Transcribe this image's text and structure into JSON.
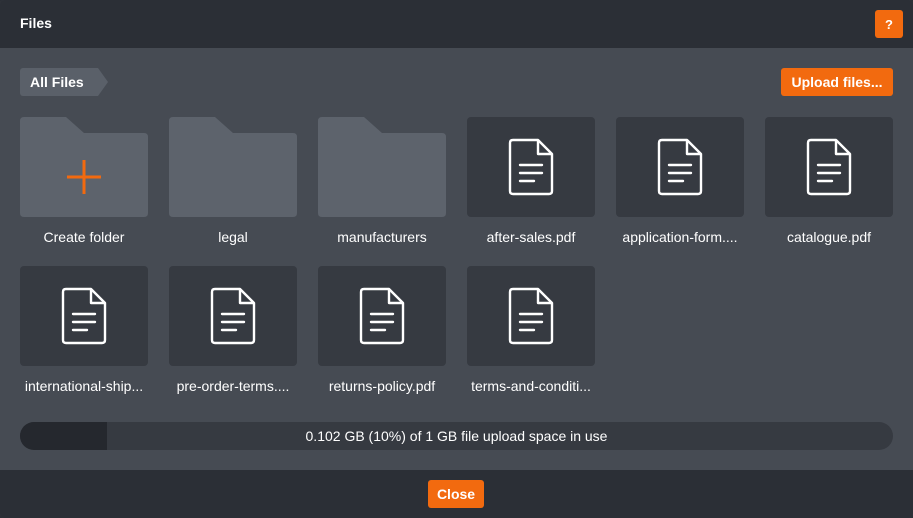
{
  "dialog": {
    "title": "Files",
    "help_label": "?"
  },
  "toolbar": {
    "breadcrumb": "All Files",
    "upload_label": "Upload files..."
  },
  "items": [
    {
      "type": "create-folder",
      "label": "Create folder",
      "icon": "plus-icon"
    },
    {
      "type": "folder",
      "label": "legal",
      "icon": "folder-icon"
    },
    {
      "type": "folder",
      "label": "manufacturers",
      "icon": "folder-icon"
    },
    {
      "type": "file",
      "label": "after-sales.pdf",
      "icon": "document-icon"
    },
    {
      "type": "file",
      "label": "application-form....",
      "icon": "document-icon"
    },
    {
      "type": "file",
      "label": "catalogue.pdf",
      "icon": "document-icon"
    },
    {
      "type": "file",
      "label": "international-ship...",
      "icon": "document-icon"
    },
    {
      "type": "file",
      "label": "pre-order-terms....",
      "icon": "document-icon"
    },
    {
      "type": "file",
      "label": "returns-policy.pdf",
      "icon": "document-icon"
    },
    {
      "type": "file",
      "label": "terms-and-conditi...",
      "icon": "document-icon"
    }
  ],
  "usage": {
    "text": "0.102 GB (10%) of 1 GB file upload space in use",
    "fraction": 0.1
  },
  "footer": {
    "close_label": "Close"
  },
  "colors": {
    "accent": "#f26a0f",
    "dialog_bg": "#464b53",
    "header_bg": "#2b2f36",
    "tile_bg": "#363a41",
    "folder": "#5d636c"
  }
}
